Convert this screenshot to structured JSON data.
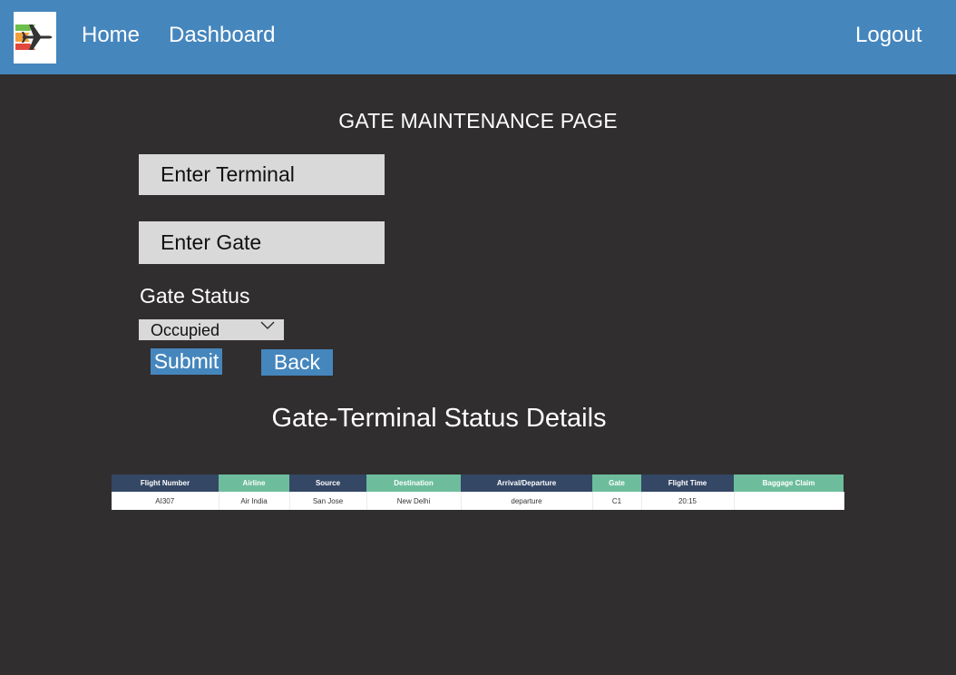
{
  "nav": {
    "home_label": "Home",
    "dashboard_label": "Dashboard",
    "logout_label": "Logout",
    "logo_icon": "airplane-logo-icon"
  },
  "page_title": "GATE MAINTENANCE PAGE",
  "form": {
    "terminal_placeholder": "Enter Terminal",
    "gate_placeholder": "Enter Gate",
    "status_label": "Gate Status",
    "status_selected": "Occupied",
    "submit_label": "Submit",
    "back_label": "Back"
  },
  "section_title": "Gate-Terminal Status Details",
  "table": {
    "headers": [
      "Flight Number",
      "Airline",
      "Source",
      "Destination",
      "Arrival/Departure",
      "Gate",
      "Flight Time",
      "Baggage Claim"
    ],
    "rows": [
      [
        "AI307",
        "Air India",
        "San Jose",
        "New Delhi",
        "departure",
        "C1",
        "20:15",
        ""
      ]
    ]
  },
  "colors": {
    "navbar": "#4586bd",
    "background": "#302e2f",
    "header_dark": "#344765",
    "header_green": "#6dbd9d",
    "button": "#4586bd"
  }
}
